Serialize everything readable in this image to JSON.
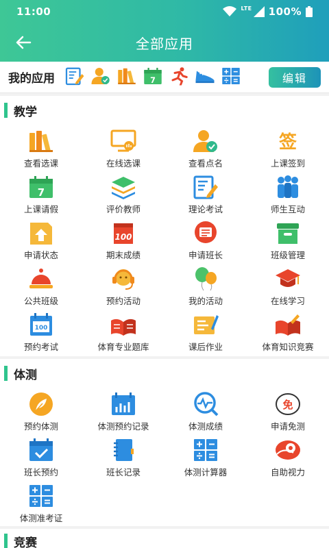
{
  "status": {
    "time": "11:00",
    "network": "LTE",
    "battery": "100%"
  },
  "header": {
    "title": "全部应用"
  },
  "my_apps": {
    "label": "我的应用",
    "edit_label": "编辑",
    "icons": [
      "exam-icon",
      "roll-call-icon",
      "books-icon",
      "calendar-leave-icon",
      "runner-icon",
      "sneaker-icon",
      "calculator-icon"
    ]
  },
  "sections": [
    {
      "title": "教学",
      "items": [
        {
          "label": "查看选课",
          "icon": "books-icon"
        },
        {
          "label": "在线选课",
          "icon": "online-course-icon"
        },
        {
          "label": "查看点名",
          "icon": "roll-call-icon"
        },
        {
          "label": "上课签到",
          "icon": "sign-in-icon"
        },
        {
          "label": "上课请假",
          "icon": "calendar-leave-icon"
        },
        {
          "label": "评价教师",
          "icon": "layers-icon"
        },
        {
          "label": "理论考试",
          "icon": "exam-icon"
        },
        {
          "label": "师生互动",
          "icon": "group-icon"
        },
        {
          "label": "申请状态",
          "icon": "status-upload-icon"
        },
        {
          "label": "期末成绩",
          "icon": "score-icon"
        },
        {
          "label": "申请班长",
          "icon": "message-icon"
        },
        {
          "label": "班级管理",
          "icon": "box-icon"
        },
        {
          "label": "公共班级",
          "icon": "bell-desk-icon"
        },
        {
          "label": "预约活动",
          "icon": "headset-icon"
        },
        {
          "label": "我的活动",
          "icon": "balloon-icon"
        },
        {
          "label": "在线学习",
          "icon": "graduation-cap-icon"
        },
        {
          "label": "预约考试",
          "icon": "exam-calendar-icon"
        },
        {
          "label": "体育专业题库",
          "icon": "open-book-icon"
        },
        {
          "label": "课后作业",
          "icon": "homework-icon"
        },
        {
          "label": "体育知识竞赛",
          "icon": "open-book-pen-icon"
        }
      ]
    },
    {
      "title": "体测",
      "items": [
        {
          "label": "预约体测",
          "icon": "feather-icon"
        },
        {
          "label": "体测预约记录",
          "icon": "bar-calendar-icon"
        },
        {
          "label": "体测成绩",
          "icon": "pulse-search-icon"
        },
        {
          "label": "申请免测",
          "icon": "exempt-icon"
        },
        {
          "label": "班长预约",
          "icon": "calendar-check-icon"
        },
        {
          "label": "班长记录",
          "icon": "notebook-icon"
        },
        {
          "label": "体测计算器",
          "icon": "calculator-icon"
        },
        {
          "label": "自助视力",
          "icon": "eye-icon"
        },
        {
          "label": "体测准考证",
          "icon": "calculator-icon"
        }
      ]
    },
    {
      "title": "竞赛",
      "items": []
    }
  ],
  "colors": {
    "header_start": "#3ec796",
    "header_end": "#1f9fbb",
    "accent": "#2fc48d",
    "orange": "#f5a623",
    "blue": "#2d8de0",
    "red": "#e8452c"
  }
}
